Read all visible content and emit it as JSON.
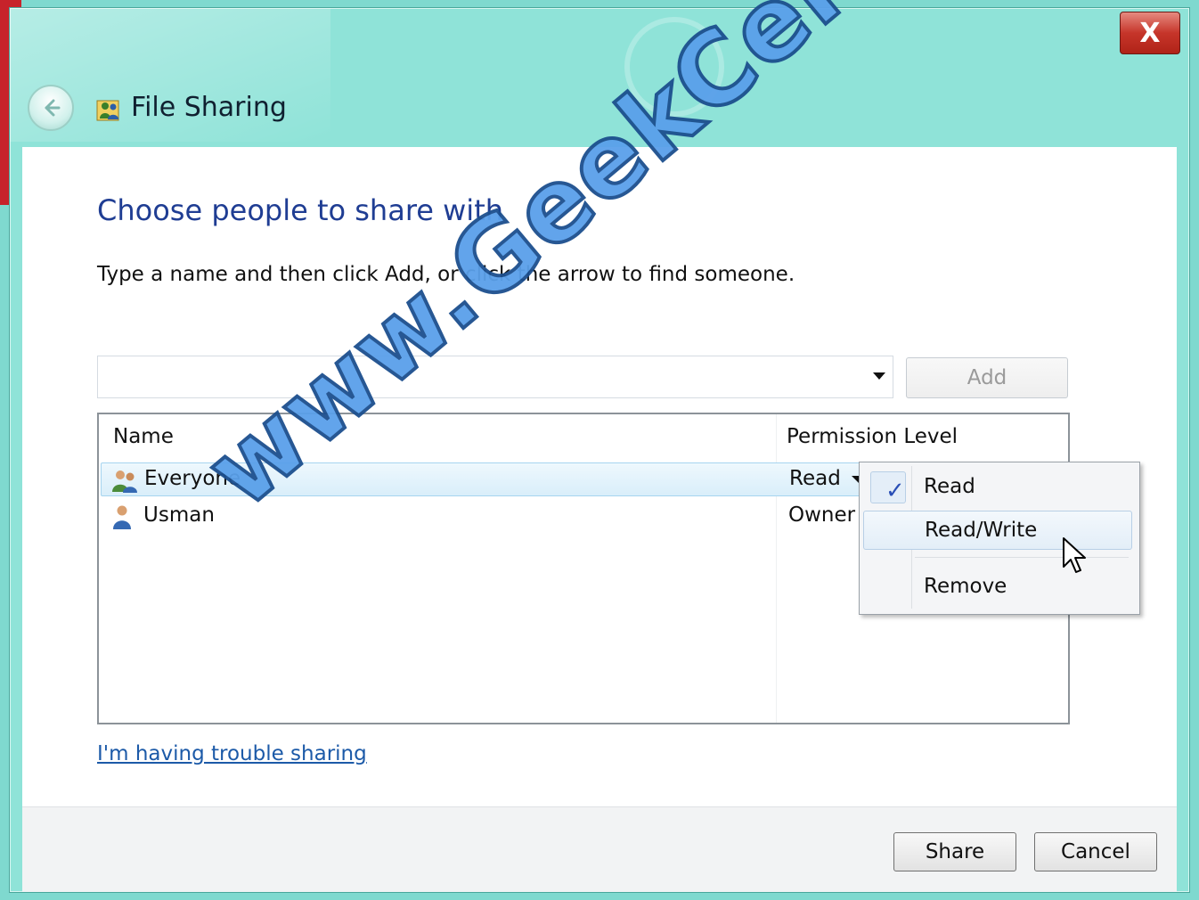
{
  "window": {
    "title": "File Sharing",
    "close_label": "X",
    "back_icon": "back-arrow-icon",
    "title_icon": "file-sharing-people-icon"
  },
  "content": {
    "heading": "Choose people to share with",
    "instruction": "Type a name and then click Add, or click the arrow to find someone.",
    "name_input": {
      "value": "",
      "placeholder": ""
    },
    "add_label": "Add",
    "columns": {
      "name": "Name",
      "permission": "Permission Level"
    },
    "rows": [
      {
        "name": "Everyone",
        "permission": "Read",
        "icon": "group-icon",
        "selected": true
      },
      {
        "name": "Usman",
        "permission": "Owner",
        "icon": "user-icon",
        "selected": false
      }
    ],
    "permission_menu": {
      "items": [
        {
          "label": "Read",
          "checked": true
        },
        {
          "label": "Read/Write",
          "hovered": true
        },
        {
          "label": "Remove"
        }
      ]
    },
    "trouble_link": "I'm having trouble sharing"
  },
  "footer": {
    "share_label": "Share",
    "cancel_label": "Cancel"
  },
  "watermark": "www.GeekCert.com",
  "colors": {
    "heading": "#1f3d93",
    "link": "#1c5aa8",
    "title_bar": "#8fe3d8",
    "close_button": "#c6352a"
  }
}
